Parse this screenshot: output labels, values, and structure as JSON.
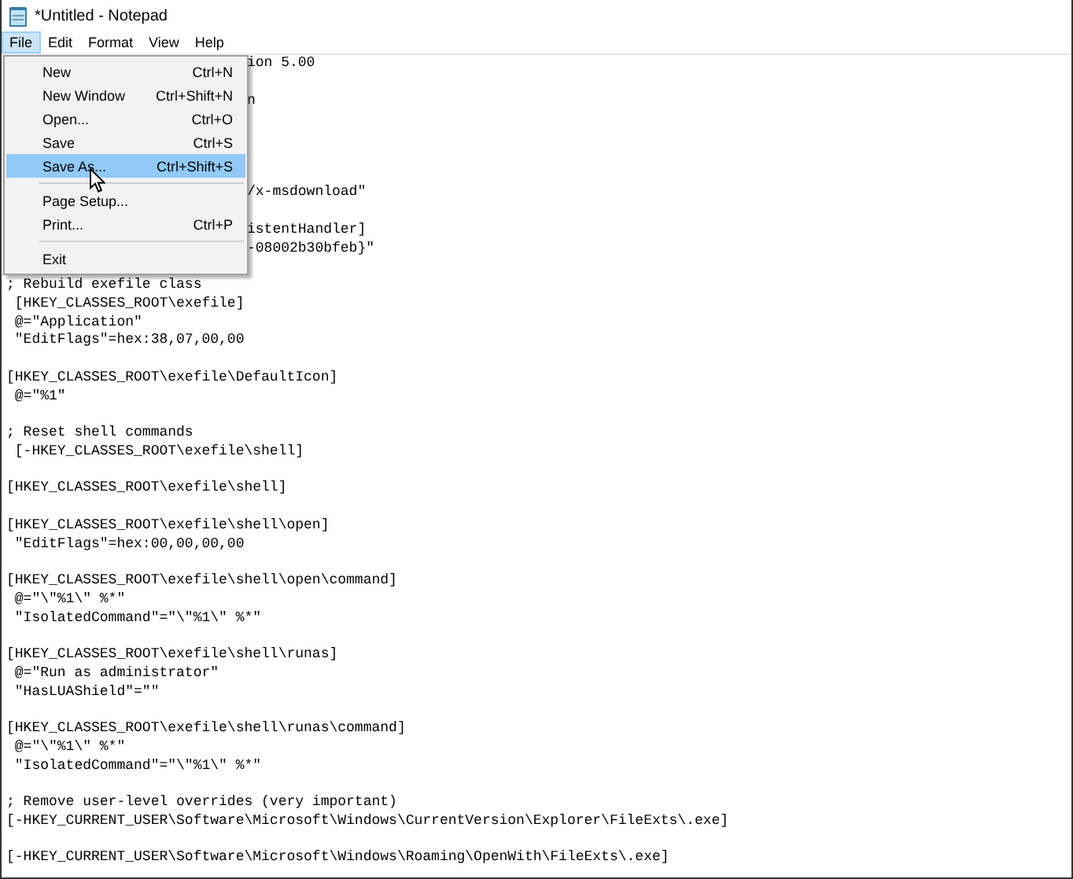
{
  "window": {
    "title": "*Untitled - Notepad"
  },
  "menu_bar": [
    {
      "label": "File",
      "selected": true
    },
    {
      "label": "Edit",
      "selected": false
    },
    {
      "label": "Format",
      "selected": false
    },
    {
      "label": "View",
      "selected": false
    },
    {
      "label": "Help",
      "selected": false
    }
  ],
  "file_menu": {
    "items": [
      {
        "kind": "item",
        "label": "New",
        "shortcut": "Ctrl+N",
        "selected": false
      },
      {
        "kind": "item",
        "label": "New Window",
        "shortcut": "Ctrl+Shift+N",
        "selected": false
      },
      {
        "kind": "item",
        "label": "Open...",
        "shortcut": "Ctrl+O",
        "selected": false
      },
      {
        "kind": "item",
        "label": "Save",
        "shortcut": "Ctrl+S",
        "selected": false
      },
      {
        "kind": "item",
        "label": "Save As...",
        "shortcut": "Ctrl+Shift+S",
        "selected": true
      },
      {
        "kind": "separator"
      },
      {
        "kind": "item",
        "label": "Page Setup...",
        "selected": false
      },
      {
        "kind": "item",
        "label": "Print...",
        "shortcut": "Ctrl+P",
        "selected": false
      },
      {
        "kind": "separator"
      },
      {
        "kind": "item",
        "label": "Exit",
        "selected": false
      }
    ]
  },
  "editor": {
    "lines": [
      {
        "kind": "covered",
        "text": "ion 5.00"
      },
      {
        "kind": "blank"
      },
      {
        "kind": "covered",
        "text": "n"
      },
      {
        "kind": "blank"
      },
      {
        "kind": "blank"
      },
      {
        "kind": "blank"
      },
      {
        "kind": "blank"
      },
      {
        "kind": "covered",
        "text": "/x-msdownload\""
      },
      {
        "kind": "blank"
      },
      {
        "kind": "covered",
        "text": "istentHandler]"
      },
      {
        "kind": "covered",
        "text": "-08002b30bfeb}\""
      },
      {
        "kind": "blank"
      },
      {
        "kind": "line",
        "text": "; Rebuild exefile class"
      },
      {
        "kind": "line",
        "text": " [HKEY_CLASSES_ROOT\\exefile]"
      },
      {
        "kind": "line",
        "text": " @=\"Application\""
      },
      {
        "kind": "line",
        "text": " \"EditFlags\"=hex:38,07,00,00"
      },
      {
        "kind": "blank"
      },
      {
        "kind": "line",
        "text": "[HKEY_CLASSES_ROOT\\exefile\\DefaultIcon]"
      },
      {
        "kind": "line",
        "text": " @=\"%1\""
      },
      {
        "kind": "blank"
      },
      {
        "kind": "line",
        "text": "; Reset shell commands"
      },
      {
        "kind": "line",
        "text": " [-HKEY_CLASSES_ROOT\\exefile\\shell]"
      },
      {
        "kind": "blank"
      },
      {
        "kind": "line",
        "text": "[HKEY_CLASSES_ROOT\\exefile\\shell]"
      },
      {
        "kind": "blank"
      },
      {
        "kind": "line",
        "text": "[HKEY_CLASSES_ROOT\\exefile\\shell\\open]"
      },
      {
        "kind": "line",
        "text": " \"EditFlags\"=hex:00,00,00,00"
      },
      {
        "kind": "blank"
      },
      {
        "kind": "line",
        "text": "[HKEY_CLASSES_ROOT\\exefile\\shell\\open\\command]"
      },
      {
        "kind": "line",
        "text": " @=\"\\\"%1\\\" %*\""
      },
      {
        "kind": "line",
        "text": " \"IsolatedCommand\"=\"\\\"%1\\\" %*\""
      },
      {
        "kind": "blank"
      },
      {
        "kind": "line",
        "text": "[HKEY_CLASSES_ROOT\\exefile\\shell\\runas]"
      },
      {
        "kind": "line",
        "text": " @=\"Run as administrator\""
      },
      {
        "kind": "line",
        "text": " \"HasLUAShield\"=\"\""
      },
      {
        "kind": "blank"
      },
      {
        "kind": "line",
        "text": "[HKEY_CLASSES_ROOT\\exefile\\shell\\runas\\command]"
      },
      {
        "kind": "line",
        "text": " @=\"\\\"%1\\\" %*\""
      },
      {
        "kind": "line",
        "text": " \"IsolatedCommand\"=\"\\\"%1\\\" %*\""
      },
      {
        "kind": "blank"
      },
      {
        "kind": "line",
        "text": "; Remove user-level overrides (very important)"
      },
      {
        "kind": "line",
        "text": "[-HKEY_CURRENT_USER\\Software\\Microsoft\\Windows\\CurrentVersion\\Explorer\\FileExts\\.exe]"
      },
      {
        "kind": "blank"
      },
      {
        "kind": "line",
        "text": "[-HKEY_CURRENT_USER\\Software\\Microsoft\\Windows\\Roaming\\OpenWith\\FileExts\\.exe]"
      }
    ]
  }
}
